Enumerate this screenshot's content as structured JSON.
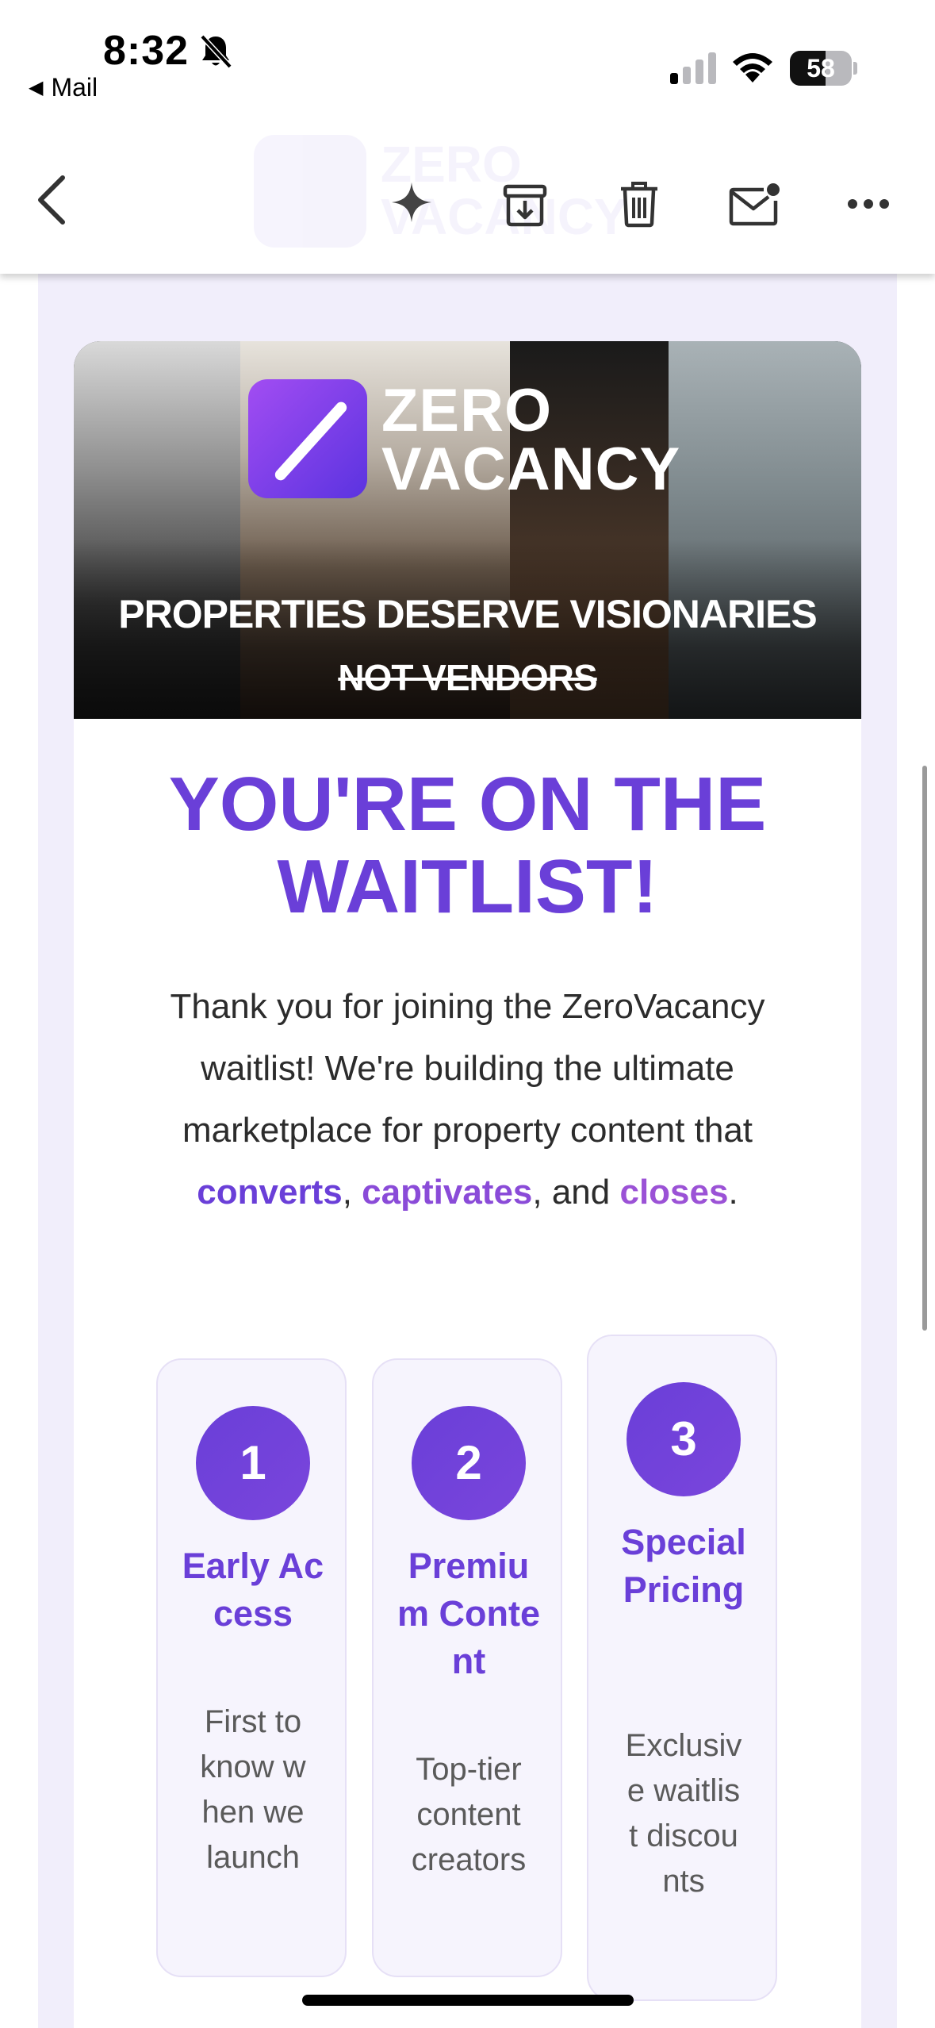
{
  "status_bar": {
    "time": "8:32",
    "back_app": "Mail",
    "battery_percent": 58,
    "battery_label": "58"
  },
  "toolbar": {
    "back_icon": "chevron-left-icon",
    "ai_icon": "sparkle-icon",
    "archive_icon": "archive-icon",
    "delete_icon": "trash-icon",
    "unread_icon": "mail-unread-icon",
    "more_icon": "ellipsis-icon"
  },
  "email": {
    "banner": {
      "brand_line1": "ZERO",
      "brand_line2": "VACANCY",
      "tagline_line1": "PROPERTIES DESERVE VISIONARIES",
      "tagline_line2": "NOT VENDORS"
    },
    "headline_line1": "YOU'RE ON THE",
    "headline_line2": "WAITLIST!",
    "intro": {
      "text_before": "Thank you for joining the ZeroVacancy waitlist! We're building the ultimate marketplace for property content that ",
      "word1": "converts",
      "sep1": ", ",
      "word2": "captivates",
      "sep2": ", and ",
      "word3": "closes",
      "end": "."
    },
    "steps": [
      {
        "number": "1",
        "title": "Early Access",
        "desc": "First to know when we launch"
      },
      {
        "number": "2",
        "title": "Premium Content",
        "desc": "Top-tier content creators"
      },
      {
        "number": "3",
        "title": "Special Pricing",
        "desc": "Exclusive waitlist discounts"
      }
    ]
  },
  "colors": {
    "accent": "#6a3fd8",
    "email_background": "#f1eefb",
    "step_card": "#f6f4fd"
  }
}
